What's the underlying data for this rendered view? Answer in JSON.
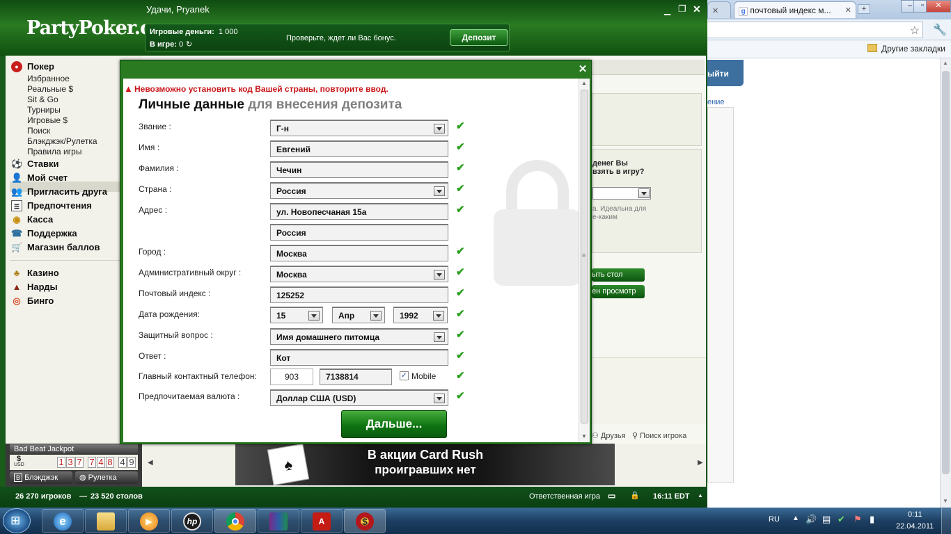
{
  "browser": {
    "tab1_label": "",
    "tab2_label": "почтовый индекс м...",
    "new_tab": "+",
    "bookmarks_label": "Другие закладки",
    "page_button": "ыйти",
    "page_link": "ение",
    "promo_q1": "денег Вы",
    "promo_q2": "взять в игру?",
    "promo_t1": "а. Идеальна для",
    "promo_t2": "е-каким",
    "btn1": "ыть стол",
    "btn2": "ен просмотр",
    "friends": "Друзья",
    "find_player": "Поиск игрока"
  },
  "app": {
    "logo": "PartyPoker.com",
    "greeting": "Удачи, Pryanek",
    "play_money_label": "Игровые деньги:",
    "play_money_value": "1 000",
    "in_game_label": "В игре:",
    "in_game_value": "0",
    "bonus_text": "Проверьте, ждет ли Вас бонус.",
    "deposit_button": "Депозит"
  },
  "sidebar": {
    "poker": "Покер",
    "sub": [
      "Избранное",
      "Реальные $",
      "Sit & Go",
      "Турниры",
      "Игровые $",
      "Поиск",
      "Блэкджэк/Рулетка",
      "Правила игры"
    ],
    "main": [
      "Ставки",
      "Мой счет",
      "Пригласить друга",
      "Предпочтения",
      "Касса",
      "Поддержка",
      "Магазин баллов"
    ],
    "extra": [
      "Казино",
      "Нарды",
      "Бинго"
    ]
  },
  "jackpot": {
    "title": "Bad Beat Jackpot",
    "currency": "$",
    "currency_sub": "USD",
    "digits": [
      "1",
      "3",
      "7",
      "7",
      "4",
      "8",
      "4",
      "9"
    ],
    "tab_blackjack": "Блэкджэк",
    "tab_roulette": "Рулетка"
  },
  "banner": {
    "line1": "В акции Card Rush",
    "line2": "проигравших нет"
  },
  "status": {
    "players": "26 270 игроков",
    "sep": "—",
    "tables": "23 520 столов",
    "responsible": "Ответственная игра",
    "clock": "16:11 EDT"
  },
  "form": {
    "error": "Невозможно установить код Вашей страны, повторите ввод.",
    "title": "Личные данные",
    "title_sub": "для внесения депозита",
    "labels": {
      "title_field": "Звание :",
      "first_name": "Имя :",
      "last_name": "Фамилия :",
      "country": "Страна :",
      "address": "Адрес :",
      "city": "Город :",
      "region": "Административный округ :",
      "zip": "Почтовый индекс :",
      "dob": "Дата рождения:",
      "security_q": "Защитный вопрос :",
      "answer": "Ответ :",
      "phone": "Главный контактный телефон:",
      "currency": "Предпочитаемая валюта :"
    },
    "values": {
      "title_field": "Г-н",
      "first_name": "Евгений",
      "last_name": "Чечин",
      "country": "Россия",
      "address1": "ул. Новопесчаная 15а",
      "address2": "Россия",
      "city": "Москва",
      "region": "Москва",
      "zip": "125252",
      "dob_day": "15",
      "dob_month": "Апр",
      "dob_year": "1992",
      "security_q": "Имя домашнего питомца",
      "answer": "Кот",
      "phone_code": "903",
      "phone_number": "7138814",
      "mobile_label": "Mobile",
      "currency": "Доллар США (USD)"
    },
    "check_mark": "✔",
    "next_button": "Дальше..."
  },
  "taskbar": {
    "lang": "RU",
    "time": "0:11",
    "date": "22.04.2011"
  }
}
